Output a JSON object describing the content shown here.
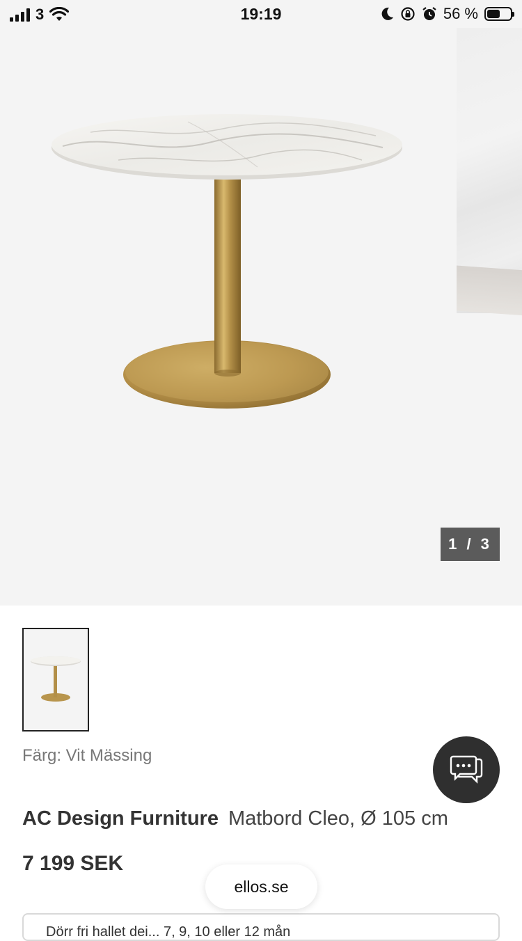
{
  "status_bar": {
    "carrier": "3",
    "time": "19:19",
    "battery_percent": "56 %",
    "battery_level": 0.56,
    "icons": [
      "signal-icon",
      "wifi-icon",
      "moon-icon",
      "rotation-lock-icon",
      "alarm-icon",
      "battery-icon"
    ]
  },
  "gallery": {
    "page_indicator": "1 / 3",
    "current_page": 1,
    "total_pages": 3
  },
  "product": {
    "color_label": "Färg: Vit Mässing",
    "brand": "AC Design Furniture",
    "name": "Matbord Cleo, Ø 105 cm",
    "price": "7 199 SEK"
  },
  "browser": {
    "domain": "ellos.se"
  },
  "bottom_box": {
    "text": "Dörr fri hallet dei... 7, 9, 10 eller 12 mån"
  },
  "colors": {
    "gallery_bg": "#f4f4f4",
    "indicator_bg": "#5b5b5b",
    "chat_button_bg": "#2f2f2f",
    "brass": "#b8954d"
  }
}
